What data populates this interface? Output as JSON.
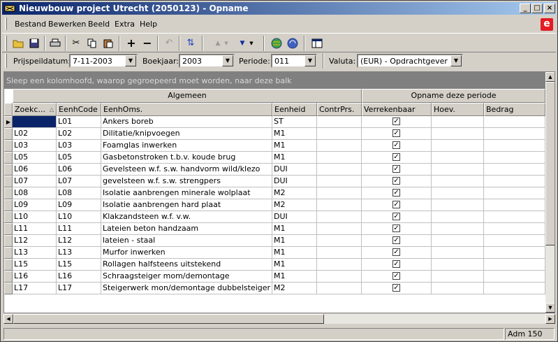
{
  "window": {
    "title": "Nieuwbouw project Utrecht (2050123) - Opname"
  },
  "menu": [
    {
      "label": "Bestand"
    },
    {
      "label": "Bewerken"
    },
    {
      "label": "Beeld"
    },
    {
      "label": "Extra"
    },
    {
      "label": "Help"
    }
  ],
  "toolbar": [
    "open-folder-icon",
    "save-icon",
    "print-icon",
    "cut-icon",
    "copy-icon",
    "paste-icon",
    "plus-icon",
    "minus-icon",
    "undo-icon",
    "sync-icon",
    "arrow-up-icon",
    "arrow-down-icon",
    "globe-icon",
    "globe-refresh-icon",
    "window-icon"
  ],
  "filters": {
    "prijspeildatum_label": "Prijspeildatum:",
    "prijspeildatum_value": "7-11-2003",
    "boekjaar_label": "Boekjaar:",
    "boekjaar_value": "2003",
    "periode_label": "Periode:",
    "periode_value": "011",
    "valuta_label": "Valuta:",
    "valuta_value": "(EUR) - Opdrachtgever"
  },
  "grid": {
    "group_hint": "Sleep een kolomhoofd, waarop gegroepeerd moet worden, naar deze balk",
    "bands": {
      "algemeen": "Algemeen",
      "opname": "Opname deze periode"
    },
    "columns": {
      "zoekcode": "Zoekc...",
      "eenhcode": "EenhCode",
      "eenhoms": "EenhOms.",
      "eenheid": "Eenheid",
      "contrprs": "ContrPrs.",
      "verrekenbaar": "Verrekenbaar",
      "hoev": "Hoev.",
      "bedrag": "Bedrag"
    },
    "rows": [
      {
        "zoekcode": "",
        "eenhcode": "L01",
        "eenhoms": "Ankers boreb",
        "eenheid": "ST",
        "verrekenbaar": true
      },
      {
        "zoekcode": "L02",
        "eenhcode": "L02",
        "eenhoms": "Dilitatie/knipvoegen",
        "eenheid": "M1",
        "verrekenbaar": true
      },
      {
        "zoekcode": "L03",
        "eenhcode": "L03",
        "eenhoms": "Foamglas inwerken",
        "eenheid": "M1",
        "verrekenbaar": true
      },
      {
        "zoekcode": "L05",
        "eenhcode": "L05",
        "eenhoms": "Gasbetonstroken t.b.v. koude brug",
        "eenheid": "M1",
        "verrekenbaar": true
      },
      {
        "zoekcode": "L06",
        "eenhcode": "L06",
        "eenhoms": "Gevelsteen w.f. s.w. handvorm wild/klezo",
        "eenheid": "DUI",
        "verrekenbaar": true
      },
      {
        "zoekcode": "L07",
        "eenhcode": "L07",
        "eenhoms": "gevelsteen w.f. s.w. strengpers",
        "eenheid": "DUI",
        "verrekenbaar": true
      },
      {
        "zoekcode": "L08",
        "eenhcode": "L08",
        "eenhoms": "Isolatie aanbrengen minerale wolplaat",
        "eenheid": "M2",
        "verrekenbaar": true
      },
      {
        "zoekcode": "L09",
        "eenhcode": "L09",
        "eenhoms": "Isolatie aanbrengen hard plaat",
        "eenheid": "M2",
        "verrekenbaar": true
      },
      {
        "zoekcode": "L10",
        "eenhcode": "L10",
        "eenhoms": "Klakzandsteen w.f. v.w.",
        "eenheid": "DUI",
        "verrekenbaar": true
      },
      {
        "zoekcode": "L11",
        "eenhcode": "L11",
        "eenhoms": "Lateien beton handzaam",
        "eenheid": "M1",
        "verrekenbaar": true
      },
      {
        "zoekcode": "L12",
        "eenhcode": "L12",
        "eenhoms": "lateien - staal",
        "eenheid": "M1",
        "verrekenbaar": true
      },
      {
        "zoekcode": "L13",
        "eenhcode": "L13",
        "eenhoms": "Murfor inwerken",
        "eenheid": "M1",
        "verrekenbaar": true
      },
      {
        "zoekcode": "L15",
        "eenhcode": "L15",
        "eenhoms": "Rollagen halfsteens uitstekend",
        "eenheid": "M1",
        "verrekenbaar": true
      },
      {
        "zoekcode": "L16",
        "eenhcode": "L16",
        "eenhoms": "Schraagsteiger mom/demontage",
        "eenheid": "M1",
        "verrekenbaar": true
      },
      {
        "zoekcode": "L17",
        "eenhcode": "L17",
        "eenhoms": "Steigerwerk mon/demontage dubbelsteiger",
        "eenheid": "M2",
        "verrekenbaar": true
      }
    ]
  },
  "status": {
    "user": "Adm 150"
  }
}
